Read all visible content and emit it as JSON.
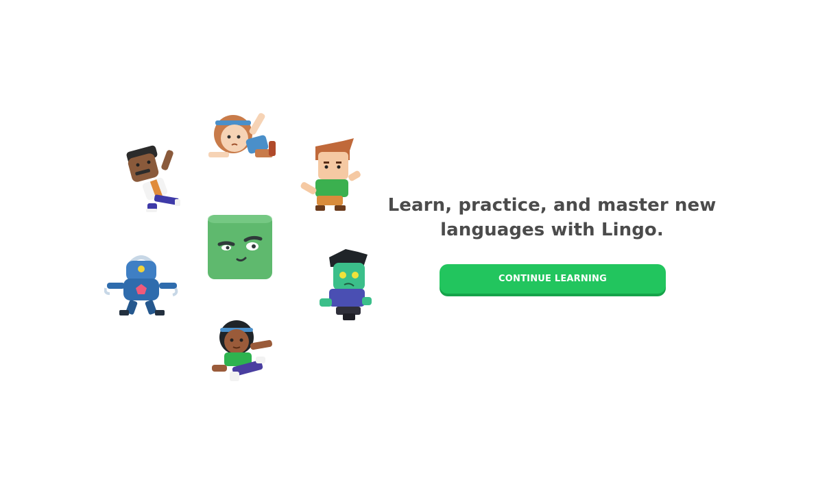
{
  "hero": {
    "tagline_line1": "Learn, practice, and master new",
    "tagline_line2": "languages with Lingo.",
    "cta_label": "CONTINUE LEARNING"
  },
  "theme": {
    "accent": "#22c55e",
    "accent_shadow": "#16a34a",
    "text": "#4b4b4b",
    "mascot": "#5fb96e"
  },
  "characters": [
    {
      "icon": "character-man-mustache-icon"
    },
    {
      "icon": "character-girl-headband-icon"
    },
    {
      "icon": "character-boy-redhair-icon"
    },
    {
      "icon": "character-robot-icon"
    },
    {
      "icon": "mascot-green-square-icon"
    },
    {
      "icon": "character-zombie-icon"
    },
    {
      "icon": "character-girl-green-shirt-icon"
    }
  ]
}
